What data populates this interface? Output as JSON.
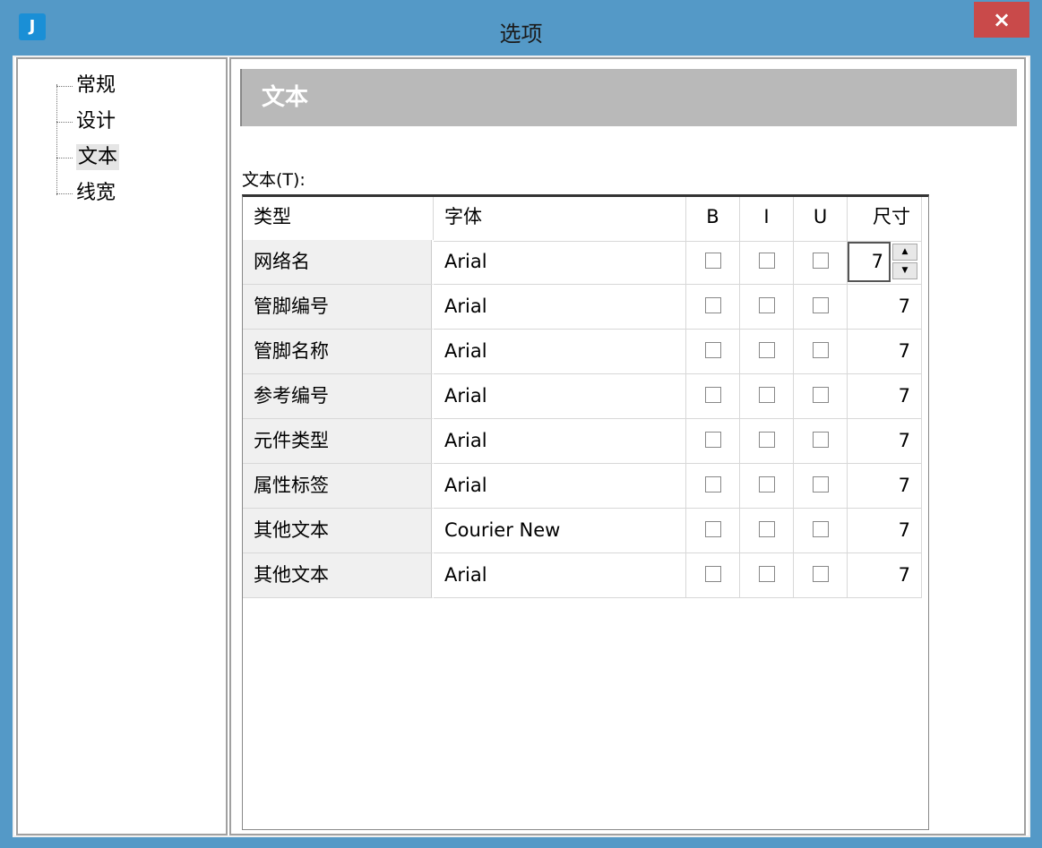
{
  "window": {
    "title": "选项",
    "close_icon": "×",
    "app_icon": "J"
  },
  "tree": {
    "items": [
      {
        "label": "常规"
      },
      {
        "label": "设计"
      },
      {
        "label": "文本",
        "selected": true
      },
      {
        "label": "线宽"
      }
    ]
  },
  "panel": {
    "header": "文本",
    "table_label": "文本(T):"
  },
  "table": {
    "columns": [
      "类型",
      "字体",
      "B",
      "I",
      "U",
      "尺寸"
    ],
    "rows": [
      {
        "type": "网络名",
        "font": "Arial",
        "b": false,
        "i": false,
        "u": false,
        "size": "7"
      },
      {
        "type": "管脚编号",
        "font": "Arial",
        "b": false,
        "i": false,
        "u": false,
        "size": "7"
      },
      {
        "type": "管脚名称",
        "font": "Arial",
        "b": false,
        "i": false,
        "u": false,
        "size": "7"
      },
      {
        "type": "参考编号",
        "font": "Arial",
        "b": false,
        "i": false,
        "u": false,
        "size": "7"
      },
      {
        "type": "元件类型",
        "font": "Arial",
        "b": false,
        "i": false,
        "u": false,
        "size": "7"
      },
      {
        "type": "属性标签",
        "font": "Arial",
        "b": false,
        "i": false,
        "u": false,
        "size": "7"
      },
      {
        "type": "其他文本",
        "font": "Courier New",
        "b": false,
        "i": false,
        "u": false,
        "size": "7"
      },
      {
        "type": "其他文本",
        "font": "Arial",
        "b": false,
        "i": false,
        "u": false,
        "size": "7"
      }
    ]
  },
  "colors": {
    "titlebar": "#5499c7",
    "close": "#c94a4a",
    "header": "#b9b9b9"
  }
}
